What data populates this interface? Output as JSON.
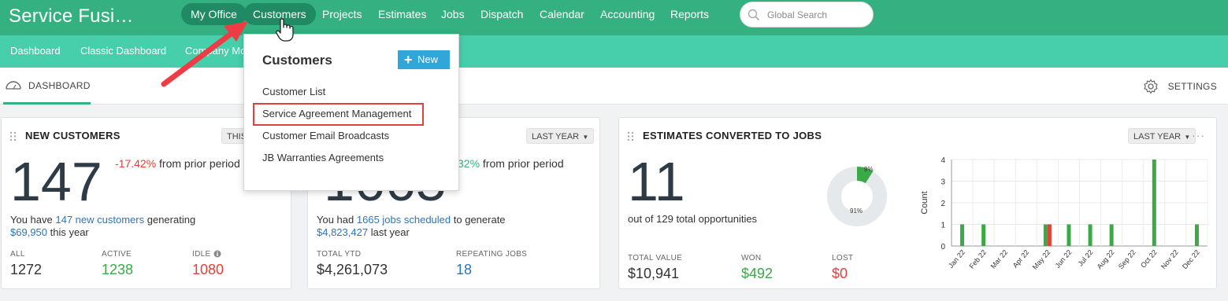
{
  "app": {
    "title": "Service Fusi…"
  },
  "topnav": {
    "items": [
      {
        "label": "My Office"
      },
      {
        "label": "Customers"
      },
      {
        "label": "Projects"
      },
      {
        "label": "Estimates"
      },
      {
        "label": "Jobs"
      },
      {
        "label": "Dispatch"
      },
      {
        "label": "Calendar"
      },
      {
        "label": "Accounting"
      },
      {
        "label": "Reports"
      }
    ],
    "search_placeholder": "Global Search"
  },
  "subnav": {
    "items": [
      {
        "label": "Dashboard"
      },
      {
        "label": "Classic Dashboard"
      },
      {
        "label": "Company Mo"
      }
    ]
  },
  "tabs": {
    "dashboard_label": "DASHBOARD",
    "settings_label": "SETTINGS"
  },
  "dropdown": {
    "title": "Customers",
    "new_label": "New",
    "items": [
      {
        "label": "Customer List"
      },
      {
        "label": "Service Agreement Management"
      },
      {
        "label": "Customer Email Broadcasts"
      },
      {
        "label": "JB Warranties Agreements"
      }
    ]
  },
  "cards": {
    "new_customers": {
      "title": "NEW CUSTOMERS",
      "period": "THIS",
      "value": "147",
      "change_pct": "-17.42%",
      "change_text": "from prior period",
      "desc_prefix": "You have",
      "desc_link": "147 new customers",
      "desc_mid": "generating",
      "desc_amount": "$69,950",
      "desc_suffix": "this year",
      "stats": [
        {
          "label": "ALL",
          "value": "1272"
        },
        {
          "label": "ACTIVE",
          "value": "1238"
        },
        {
          "label": "IDLE",
          "value": "1080"
        }
      ]
    },
    "jobs": {
      "period": "LAST YEAR",
      "value": "1665",
      "change_pct": "32%",
      "change_text": "from prior period",
      "desc_prefix": "You had",
      "desc_link": "1665 jobs scheduled",
      "desc_mid": "to generate",
      "desc_amount": "$4,823,427",
      "desc_suffix": "last year",
      "stats": [
        {
          "label": "TOTAL YTD",
          "value": "$4,261,073"
        },
        {
          "label": "REPEATING JOBS",
          "value": "18"
        }
      ]
    },
    "estimates": {
      "title": "ESTIMATES CONVERTED TO JOBS",
      "period": "LAST YEAR",
      "more": "···",
      "value": "11",
      "subtitle": "out of 129 total opportunities",
      "donut": {
        "won_pct_label": "9%",
        "other_pct_label": "91%",
        "won_fraction": 0.09
      },
      "stats": [
        {
          "label": "TOTAL VALUE",
          "value": "$10,941"
        },
        {
          "label": "WON",
          "value": "$492"
        },
        {
          "label": "LOST",
          "value": "$0"
        }
      ]
    }
  },
  "chart_data": {
    "type": "bar",
    "ylabel": "Count",
    "ylim": [
      0,
      4
    ],
    "yticks": [
      "0",
      "1",
      "2",
      "3",
      "4"
    ],
    "categories": [
      "Jan 22",
      "Feb 22",
      "Mar 22",
      "Apr 22",
      "May 22",
      "Jun 22",
      "Jul 22",
      "Aug 22",
      "Sep 22",
      "Oct 22",
      "Nov 22",
      "Dec 22"
    ],
    "series": [
      {
        "color": "#3aaa46",
        "values": [
          1,
          1,
          0,
          0,
          1,
          1,
          1,
          1,
          0,
          4,
          0,
          1
        ]
      },
      {
        "color": "#e0413a",
        "values": [
          0,
          0,
          0,
          0,
          1,
          0,
          0,
          0,
          0,
          0,
          0,
          0
        ]
      }
    ],
    "grid": true
  },
  "colors": {
    "primary": "#34b081",
    "subnav": "#46cfaa",
    "accent": "#30a7d8",
    "negative": "#e0413a",
    "positive": "#3aaa46"
  }
}
